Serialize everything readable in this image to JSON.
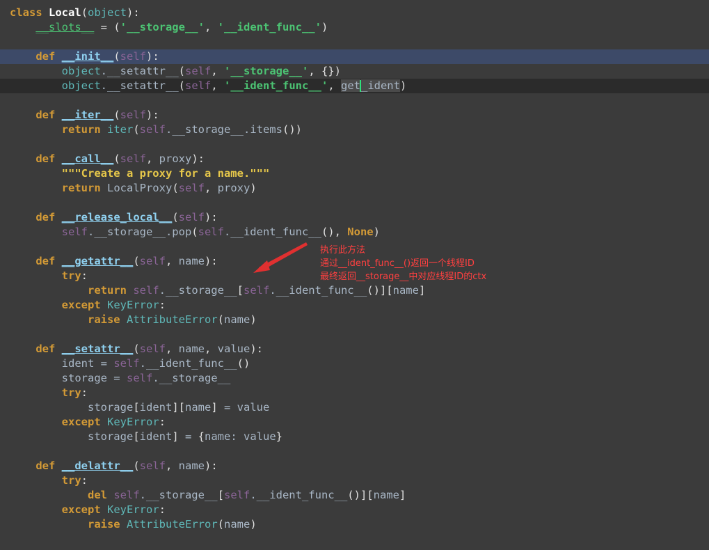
{
  "colors": {
    "background": "#3b3b3b",
    "selected_line": "#3d4a68",
    "current_line": "#2b2b2b",
    "keyword": "#d39a36",
    "function_name": "#8fd0ef",
    "self": "#8a6496",
    "builtin": "#5fb8b8",
    "string": "#4cc373",
    "docstring": "#e6c74a",
    "annotation": "#ff4040"
  },
  "code_lines": [
    {
      "hl": "",
      "tokens": [
        [
          "kw",
          "class"
        ],
        [
          "name",
          " "
        ],
        [
          "cls",
          "Local"
        ],
        [
          "punct",
          "("
        ],
        [
          "bi",
          "object"
        ],
        [
          "punct",
          "):"
        ]
      ]
    },
    {
      "hl": "",
      "tokens": [
        [
          "name",
          "    "
        ],
        [
          "dunder",
          "__slots__"
        ],
        [
          "punct",
          " = ("
        ],
        [
          "str",
          "'__storage__'"
        ],
        [
          "punct",
          ", "
        ],
        [
          "str",
          "'__ident_func__'"
        ],
        [
          "punct",
          ")"
        ]
      ]
    },
    {
      "hl": "",
      "tokens": []
    },
    {
      "hl": "selected",
      "tokens": [
        [
          "name",
          "    "
        ],
        [
          "kw",
          "def"
        ],
        [
          "name",
          " "
        ],
        [
          "fn",
          "__init__"
        ],
        [
          "punct",
          "("
        ],
        [
          "self",
          "self"
        ],
        [
          "punct",
          "):"
        ]
      ]
    },
    {
      "hl": "",
      "tokens": [
        [
          "name",
          "        "
        ],
        [
          "bi",
          "object"
        ],
        [
          "name",
          "."
        ],
        [
          "name",
          "__setattr__"
        ],
        [
          "punct",
          "("
        ],
        [
          "self",
          "self"
        ],
        [
          "punct",
          ", "
        ],
        [
          "str",
          "'__storage__'"
        ],
        [
          "punct",
          ", {})"
        ]
      ]
    },
    {
      "hl": "current",
      "tokens": [
        [
          "name",
          "        "
        ],
        [
          "bi",
          "object"
        ],
        [
          "name",
          "."
        ],
        [
          "name",
          "__setattr__"
        ],
        [
          "punct",
          "("
        ],
        [
          "self",
          "self"
        ],
        [
          "punct",
          ", "
        ],
        [
          "str",
          "'__ident_func__'"
        ],
        [
          "punct",
          ", "
        ],
        [
          "mark",
          "get"
        ],
        [
          "caret",
          ""
        ],
        [
          "mark",
          "_ident"
        ],
        [
          "punct",
          ")"
        ]
      ]
    },
    {
      "hl": "",
      "tokens": []
    },
    {
      "hl": "",
      "tokens": [
        [
          "name",
          "    "
        ],
        [
          "kw",
          "def"
        ],
        [
          "name",
          " "
        ],
        [
          "fn",
          "__iter__"
        ],
        [
          "punct",
          "("
        ],
        [
          "self",
          "self"
        ],
        [
          "punct",
          "):"
        ]
      ]
    },
    {
      "hl": "",
      "tokens": [
        [
          "name",
          "        "
        ],
        [
          "kw",
          "return"
        ],
        [
          "name",
          " "
        ],
        [
          "bi",
          "iter"
        ],
        [
          "punct",
          "("
        ],
        [
          "self",
          "self"
        ],
        [
          "name",
          ".__storage__.items"
        ],
        [
          "punct",
          "())"
        ]
      ]
    },
    {
      "hl": "",
      "tokens": []
    },
    {
      "hl": "",
      "tokens": [
        [
          "name",
          "    "
        ],
        [
          "kw",
          "def"
        ],
        [
          "name",
          " "
        ],
        [
          "fn",
          "__call__"
        ],
        [
          "punct",
          "("
        ],
        [
          "self",
          "self"
        ],
        [
          "punct",
          ", "
        ],
        [
          "name",
          "proxy"
        ],
        [
          "punct",
          "):"
        ]
      ]
    },
    {
      "hl": "",
      "tokens": [
        [
          "name",
          "        "
        ],
        [
          "dstr",
          "\"\"\"Create a proxy for a name.\"\"\""
        ]
      ]
    },
    {
      "hl": "",
      "tokens": [
        [
          "name",
          "        "
        ],
        [
          "kw",
          "return"
        ],
        [
          "name",
          " LocalProxy"
        ],
        [
          "punct",
          "("
        ],
        [
          "self",
          "self"
        ],
        [
          "punct",
          ", "
        ],
        [
          "name",
          "proxy"
        ],
        [
          "punct",
          ")"
        ]
      ]
    },
    {
      "hl": "",
      "tokens": []
    },
    {
      "hl": "",
      "tokens": [
        [
          "name",
          "    "
        ],
        [
          "kw",
          "def"
        ],
        [
          "name",
          " "
        ],
        [
          "fn",
          "__release_local__"
        ],
        [
          "punct",
          "("
        ],
        [
          "self",
          "self"
        ],
        [
          "punct",
          "):"
        ]
      ]
    },
    {
      "hl": "",
      "tokens": [
        [
          "name",
          "        "
        ],
        [
          "self",
          "self"
        ],
        [
          "name",
          ".__storage__.pop"
        ],
        [
          "punct",
          "("
        ],
        [
          "self",
          "self"
        ],
        [
          "name",
          ".__ident_func__"
        ],
        [
          "punct",
          "(), "
        ],
        [
          "kw",
          "None"
        ],
        [
          "punct",
          ")"
        ]
      ]
    },
    {
      "hl": "",
      "tokens": []
    },
    {
      "hl": "",
      "tokens": [
        [
          "name",
          "    "
        ],
        [
          "kw",
          "def"
        ],
        [
          "name",
          " "
        ],
        [
          "fn",
          "__getattr__"
        ],
        [
          "punct",
          "("
        ],
        [
          "self",
          "self"
        ],
        [
          "punct",
          ", "
        ],
        [
          "name",
          "name"
        ],
        [
          "punct",
          "):"
        ]
      ]
    },
    {
      "hl": "",
      "tokens": [
        [
          "name",
          "        "
        ],
        [
          "kw",
          "try"
        ],
        [
          "punct",
          ":"
        ]
      ]
    },
    {
      "hl": "",
      "tokens": [
        [
          "name",
          "            "
        ],
        [
          "kw",
          "return"
        ],
        [
          "name",
          " "
        ],
        [
          "self",
          "self"
        ],
        [
          "name",
          ".__storage__"
        ],
        [
          "punct",
          "["
        ],
        [
          "self",
          "self"
        ],
        [
          "name",
          ".__ident_func__"
        ],
        [
          "punct",
          "()]["
        ],
        [
          "name",
          "name"
        ],
        [
          "punct",
          "]"
        ]
      ]
    },
    {
      "hl": "",
      "tokens": [
        [
          "name",
          "        "
        ],
        [
          "kw",
          "except"
        ],
        [
          "name",
          " "
        ],
        [
          "bi",
          "KeyError"
        ],
        [
          "punct",
          ":"
        ]
      ]
    },
    {
      "hl": "",
      "tokens": [
        [
          "name",
          "            "
        ],
        [
          "kw",
          "raise"
        ],
        [
          "name",
          " "
        ],
        [
          "bi",
          "AttributeError"
        ],
        [
          "punct",
          "("
        ],
        [
          "name",
          "name"
        ],
        [
          "punct",
          ")"
        ]
      ]
    },
    {
      "hl": "",
      "tokens": []
    },
    {
      "hl": "",
      "tokens": [
        [
          "name",
          "    "
        ],
        [
          "kw",
          "def"
        ],
        [
          "name",
          " "
        ],
        [
          "fn",
          "__setattr__"
        ],
        [
          "punct",
          "("
        ],
        [
          "self",
          "self"
        ],
        [
          "punct",
          ", "
        ],
        [
          "name",
          "name"
        ],
        [
          "punct",
          ", "
        ],
        [
          "name",
          "value"
        ],
        [
          "punct",
          "):"
        ]
      ]
    },
    {
      "hl": "",
      "tokens": [
        [
          "name",
          "        ident = "
        ],
        [
          "self",
          "self"
        ],
        [
          "name",
          ".__ident_func__"
        ],
        [
          "punct",
          "()"
        ]
      ]
    },
    {
      "hl": "",
      "tokens": [
        [
          "name",
          "        storage = "
        ],
        [
          "self",
          "self"
        ],
        [
          "name",
          ".__storage__"
        ]
      ]
    },
    {
      "hl": "",
      "tokens": [
        [
          "name",
          "        "
        ],
        [
          "kw",
          "try"
        ],
        [
          "punct",
          ":"
        ]
      ]
    },
    {
      "hl": "",
      "tokens": [
        [
          "name",
          "            storage"
        ],
        [
          "punct",
          "["
        ],
        [
          "name",
          "ident"
        ],
        [
          "punct",
          "]["
        ],
        [
          "name",
          "name"
        ],
        [
          "punct",
          "]"
        ],
        [
          "name",
          " = value"
        ]
      ]
    },
    {
      "hl": "",
      "tokens": [
        [
          "name",
          "        "
        ],
        [
          "kw",
          "except"
        ],
        [
          "name",
          " "
        ],
        [
          "bi",
          "KeyError"
        ],
        [
          "punct",
          ":"
        ]
      ]
    },
    {
      "hl": "",
      "tokens": [
        [
          "name",
          "            storage"
        ],
        [
          "punct",
          "["
        ],
        [
          "name",
          "ident"
        ],
        [
          "punct",
          "]"
        ],
        [
          "name",
          " = "
        ],
        [
          "punct",
          "{"
        ],
        [
          "name",
          "name: value"
        ],
        [
          "punct",
          "}"
        ]
      ]
    },
    {
      "hl": "",
      "tokens": []
    },
    {
      "hl": "",
      "tokens": [
        [
          "name",
          "    "
        ],
        [
          "kw",
          "def"
        ],
        [
          "name",
          " "
        ],
        [
          "fn",
          "__delattr__"
        ],
        [
          "punct",
          "("
        ],
        [
          "self",
          "self"
        ],
        [
          "punct",
          ", "
        ],
        [
          "name",
          "name"
        ],
        [
          "punct",
          "):"
        ]
      ]
    },
    {
      "hl": "",
      "tokens": [
        [
          "name",
          "        "
        ],
        [
          "kw",
          "try"
        ],
        [
          "punct",
          ":"
        ]
      ]
    },
    {
      "hl": "",
      "tokens": [
        [
          "name",
          "            "
        ],
        [
          "kw",
          "del"
        ],
        [
          "name",
          " "
        ],
        [
          "self",
          "self"
        ],
        [
          "name",
          ".__storage__"
        ],
        [
          "punct",
          "["
        ],
        [
          "self",
          "self"
        ],
        [
          "name",
          ".__ident_func__"
        ],
        [
          "punct",
          "()]["
        ],
        [
          "name",
          "name"
        ],
        [
          "punct",
          "]"
        ]
      ]
    },
    {
      "hl": "",
      "tokens": [
        [
          "name",
          "        "
        ],
        [
          "kw",
          "except"
        ],
        [
          "name",
          " "
        ],
        [
          "bi",
          "KeyError"
        ],
        [
          "punct",
          ":"
        ]
      ]
    },
    {
      "hl": "",
      "tokens": [
        [
          "name",
          "            "
        ],
        [
          "kw",
          "raise"
        ],
        [
          "name",
          " "
        ],
        [
          "bi",
          "AttributeError"
        ],
        [
          "punct",
          "("
        ],
        [
          "name",
          "name"
        ],
        [
          "punct",
          ")"
        ]
      ]
    }
  ],
  "annotation": {
    "line1": "执行此方法",
    "line2": "通过__ident_func__()返回一个线程ID",
    "line3": "最终返回__storage__中对应线程ID的ctx"
  }
}
